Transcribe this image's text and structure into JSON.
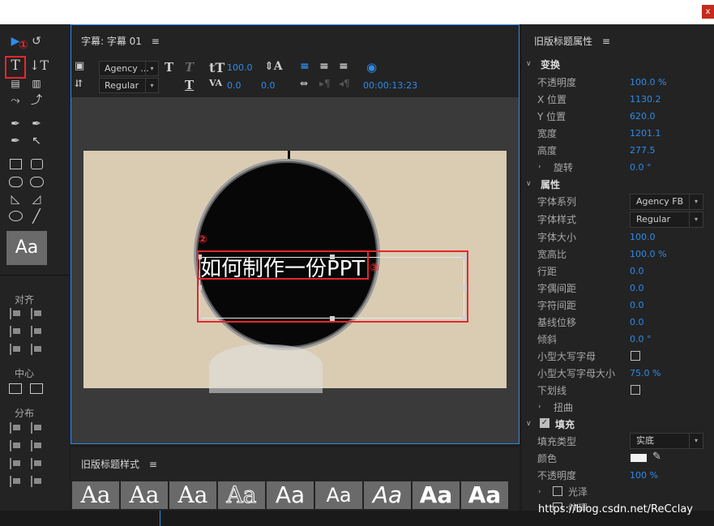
{
  "window": {
    "close_label": "x"
  },
  "toolbox": {
    "align_label": "对齐",
    "center_label": "中心",
    "distribute_label": "分布",
    "style_sample": "Aa"
  },
  "title_panel": {
    "tab_label": "字幕: 字幕 01",
    "menu_icon": "≡",
    "font_family": "Agency ...",
    "font_style": "Regular",
    "font_size": "100.0",
    "kerning": "0.0",
    "leading": "0.0",
    "timecode": "00:00:13:23",
    "subtitle_text": "如何制作一份PPT"
  },
  "annotations": {
    "mark1": "①",
    "mark2": "②",
    "mark3": "③"
  },
  "styles_panel": {
    "tab_label": "旧版标题样式",
    "menu_icon": "≡",
    "samples": [
      "Aa",
      "Aa",
      "Aa",
      "Aa",
      "Aa",
      "Aa",
      "Aa",
      "Aa",
      "Aa"
    ]
  },
  "properties": {
    "title": "旧版标题属性",
    "menu_icon": "≡",
    "transform": {
      "label": "变换",
      "opacity_label": "不透明度",
      "opacity": "100.0 %",
      "x_label": "X 位置",
      "x": "1130.2",
      "y_label": "Y 位置",
      "y": "620.0",
      "width_label": "宽度",
      "width": "1201.1",
      "height_label": "高度",
      "height": "277.5",
      "rotation_label": "旋转",
      "rotation": "0.0 °"
    },
    "attributes": {
      "label": "属性",
      "font_family_label": "字体系列",
      "font_family": "Agency FB",
      "font_style_label": "字体样式",
      "font_style": "Regular",
      "font_size_label": "字体大小",
      "font_size": "100.0",
      "aspect_label": "宽高比",
      "aspect": "100.0 %",
      "leading_label": "行距",
      "leading": "0.0",
      "kerning_label": "字偶间距",
      "kerning": "0.0",
      "tracking_label": "字符间距",
      "tracking": "0.0",
      "baseline_label": "基线位移",
      "baseline": "0.0",
      "slant_label": "倾斜",
      "slant": "0.0 °",
      "small_caps_label": "小型大写字母",
      "small_caps_size_label": "小型大写字母大小",
      "small_caps_size": "75.0 %",
      "underline_label": "下划线",
      "distort_label": "扭曲"
    },
    "fill": {
      "label": "填充",
      "type_label": "填充类型",
      "type": "实底",
      "color_label": "颜色",
      "opacity_label": "不透明度",
      "opacity": "100 %",
      "sheen_label": "光泽",
      "texture_label": "纹理"
    }
  },
  "watermark": "https://blog.csdn.net/ReCclay",
  "colors": {
    "accent": "#2d8ceb",
    "annotation_red": "#e8262d",
    "panel_bg": "#232323"
  }
}
